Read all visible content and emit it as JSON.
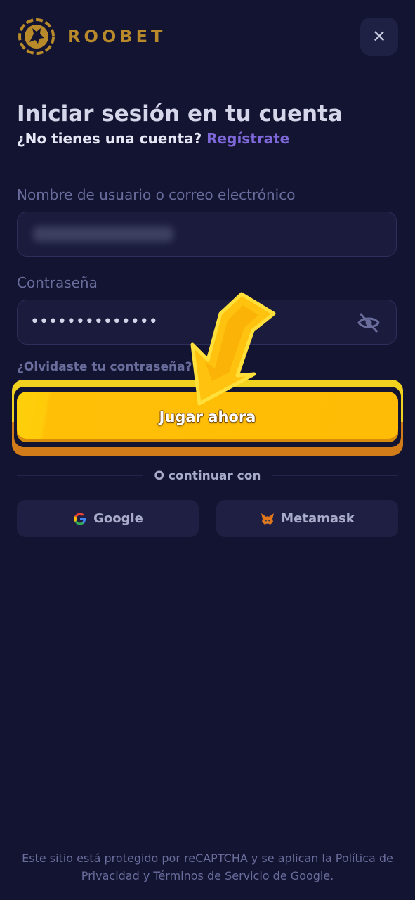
{
  "header": {
    "brand": "ROOBET",
    "close_symbol": "✕"
  },
  "login": {
    "title": "Iniciar sesión en tu cuenta",
    "no_account": "¿No tienes una cuenta?",
    "register_link": "Regístrate",
    "username_label": "Nombre de usuario o correo electrónico",
    "username_value": "",
    "password_label": "Contraseña",
    "password_value": "••••••••••••••",
    "forgot_password": "¿Olvidaste tu contraseña?",
    "submit_label": "Jugar ahora"
  },
  "social": {
    "divider_text": "O continuar con",
    "google_label": "Google",
    "metamask_label": "Metamask"
  },
  "footer": {
    "recaptcha_text": "Este sitio está protegido por reCAPTCHA y se aplican la Política de Privacidad y Términos de Servicio de Google."
  },
  "icons": {
    "logo": "roobet-logo-icon",
    "close": "close-icon",
    "eye": "eye-slash-icon",
    "google": "google-icon",
    "metamask": "metamask-icon",
    "arrow": "pointer-arrow-icon"
  },
  "colors": {
    "background": "#131431",
    "brand_gold": "#B88A2A",
    "primary_button": "#FFBC06",
    "link_purple": "#7E67D8",
    "muted_text": "#6A6C9C"
  }
}
